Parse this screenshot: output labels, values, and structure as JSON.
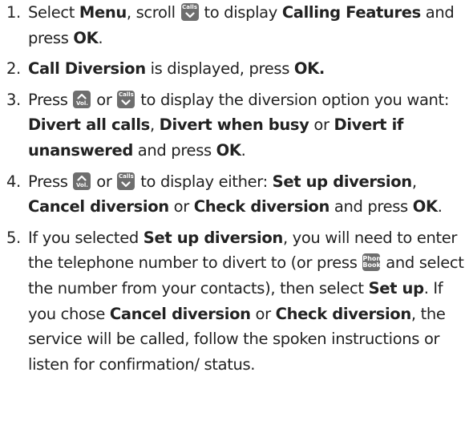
{
  "icons": {
    "calls_down": {
      "name": "calls-down-key-icon",
      "label": "Calls"
    },
    "vol_up": {
      "name": "vol-up-key-icon",
      "label": "Vol."
    },
    "phonebook": {
      "name": "phone-book-key-icon",
      "label_line1": "Phone",
      "label_line2": "Book"
    }
  },
  "steps": [
    {
      "number": "1.",
      "t1": "Select ",
      "b1": "Menu",
      "t2": ", scroll ",
      "t3": " to display ",
      "b2": "Calling Features",
      "t4": " and press ",
      "b3": "OK",
      "t5": "."
    },
    {
      "number": "2.",
      "b1": "Call Diversion",
      "t1": " is displayed, press ",
      "b2": "OK.",
      "t2": ""
    },
    {
      "number": "3.",
      "t1": "Press ",
      "t2": " or ",
      "t3": " to display the diversion option you want: ",
      "b1": "Divert all calls",
      "t4": ", ",
      "b2": "Divert when busy",
      "t5": " or ",
      "b3": "Divert if unanswered",
      "t6": " and press ",
      "b4": "OK",
      "t7": "."
    },
    {
      "number": "4.",
      "t1": "Press ",
      "t2": " or ",
      "t3": " to display either: ",
      "b1": "Set up diversion",
      "t4": ", ",
      "b2": "Cancel diversion",
      "t5": " or ",
      "b3": "Check diversion",
      "t6": " and press ",
      "b4": "OK",
      "t7": "."
    },
    {
      "number": "5.",
      "t1": "If you selected ",
      "b1": "Set up diversion",
      "t2": ", you will need to enter the telephone number to divert to (or press ",
      "t3": " and select the number from your contacts), then select ",
      "b2": "Set up",
      "t4": ". If you chose ",
      "b3": "Cancel diversion",
      "t5": " or ",
      "b4": "Check diversion",
      "t6": ", the service will be called, follow the spoken instructions or listen for confirmation/ status."
    }
  ]
}
